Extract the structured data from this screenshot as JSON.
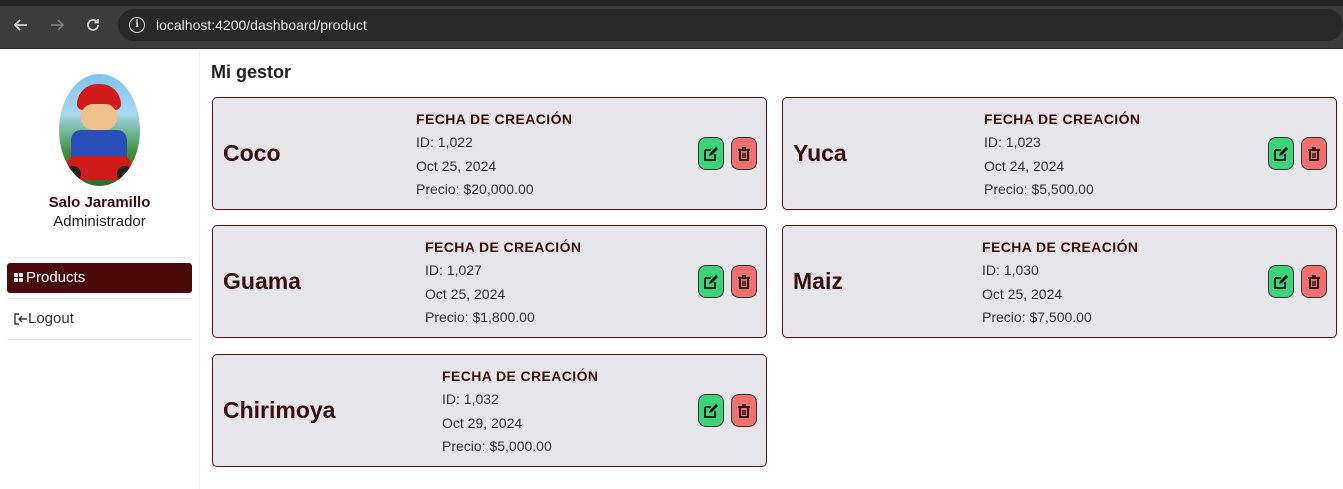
{
  "browser": {
    "url": "localhost:4200/dashboard/product",
    "back_icon": "arrow-left-icon",
    "forward_icon": "arrow-right-icon",
    "reload_icon": "reload-icon",
    "info_icon": "info-icon"
  },
  "sidebar": {
    "user_name": "Salo Jaramillo",
    "user_role": "Administrador",
    "menu": [
      {
        "label": "Products",
        "icon": "grid-icon",
        "active": true
      },
      {
        "label": "Logout",
        "icon": "logout-icon",
        "active": false
      }
    ]
  },
  "main": {
    "title": "Mi gestor",
    "creation_label": "FECHA DE CREACIÓN",
    "products": [
      {
        "name": "Coco",
        "id": "ID: 1,022",
        "date": "Oct 25, 2024",
        "price": "Precio: $20,000.00"
      },
      {
        "name": "Yuca",
        "id": "ID: 1,023",
        "date": "Oct 24, 2024",
        "price": "Precio: $5,500.00"
      },
      {
        "name": "Guama",
        "id": "ID: 1,027",
        "date": "Oct 25, 2024",
        "price": "Precio: $1,800.00"
      },
      {
        "name": "Maiz",
        "id": "ID: 1,030",
        "date": "Oct 25, 2024",
        "price": "Precio: $7,500.00"
      },
      {
        "name": "Chirimoya",
        "id": "ID: 1,032",
        "date": "Oct 29, 2024",
        "price": "Precio: $5,000.00"
      }
    ]
  },
  "colors": {
    "accent": "#4a0a0a",
    "edit_button": "#3ed37b",
    "delete_button": "#f07070",
    "card_bg": "#e6e6ea"
  }
}
